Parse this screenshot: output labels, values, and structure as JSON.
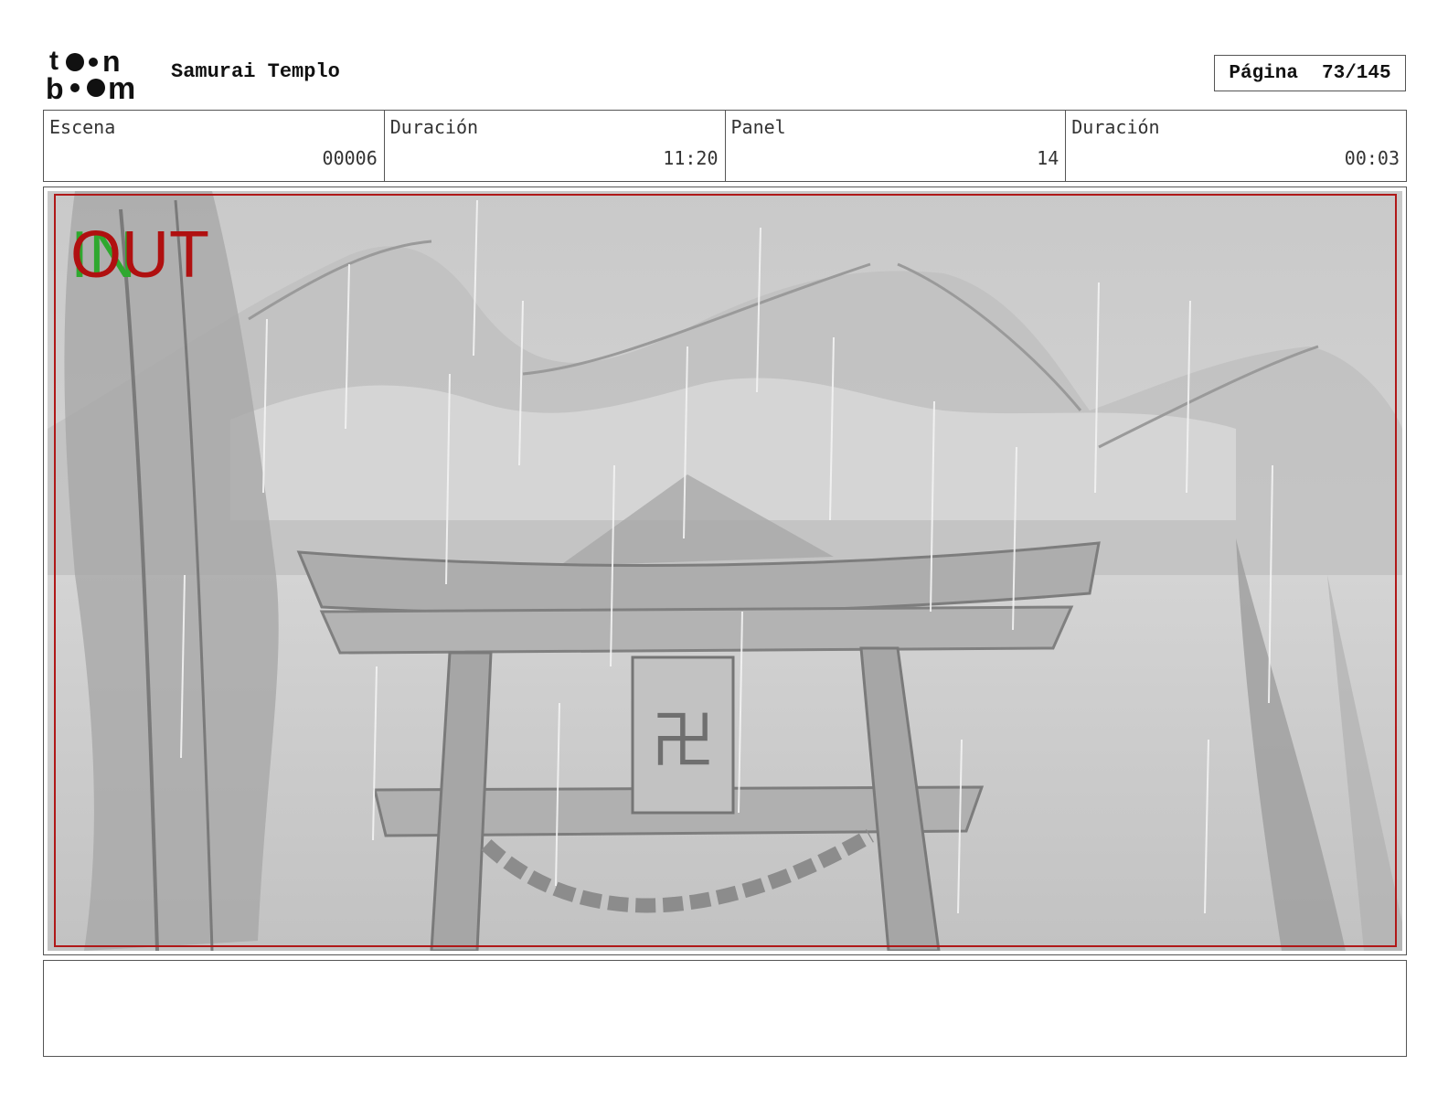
{
  "header": {
    "logo_name": "toon-boom-logo",
    "project_title": "Samurai Templo",
    "page_label": "Página",
    "page_value": "73/145"
  },
  "info": [
    {
      "label": "Escena",
      "value": "00006"
    },
    {
      "label": "Duración",
      "value": "11:20"
    },
    {
      "label": "Panel",
      "value": "14"
    },
    {
      "label": "Duración",
      "value": "00:03"
    }
  ],
  "panel": {
    "in_marker": "IN",
    "out_marker": "OUT",
    "sign_glyph": "卍",
    "colors": {
      "safe_frame": "#b01818",
      "in": "#2fa82f",
      "out": "#b01010"
    }
  },
  "notes": {
    "text": ""
  }
}
